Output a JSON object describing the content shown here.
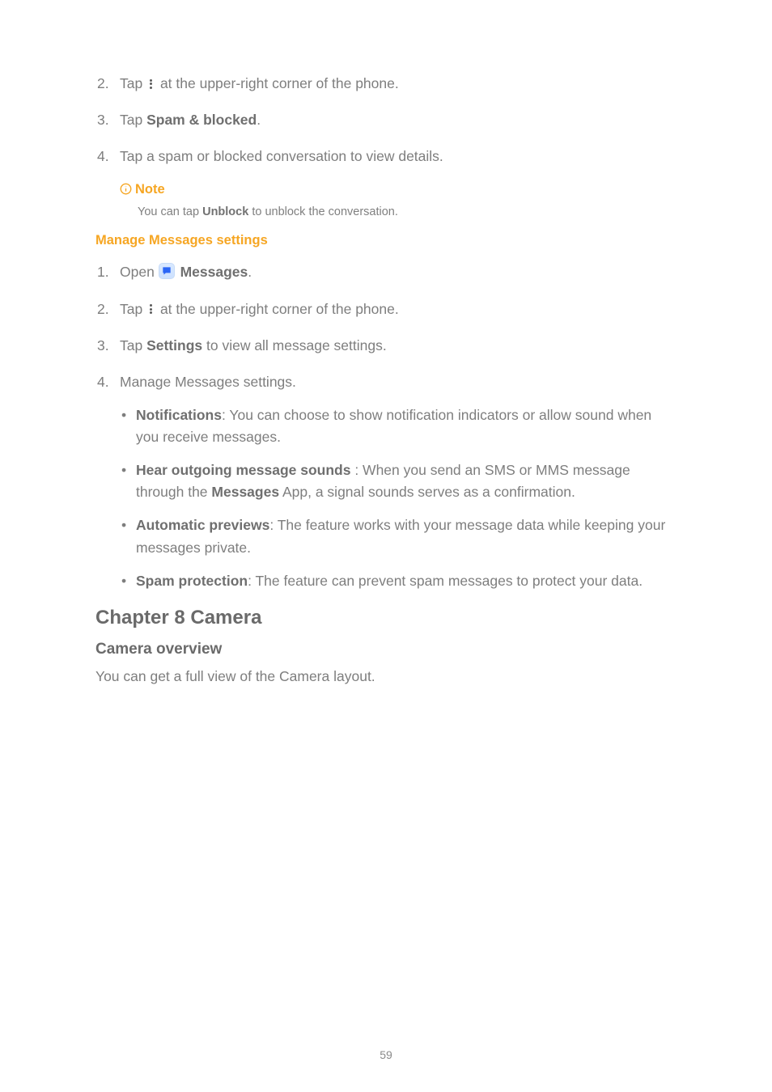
{
  "listA": {
    "i2_pre": "Tap ",
    "i2_post": " at the upper-right corner of the phone.",
    "i3_pre": "Tap ",
    "i3_bold": "Spam & blocked",
    "i3_post": ".",
    "i4": "Tap a spam or blocked conversation to view details."
  },
  "note": {
    "label": "Note",
    "body_pre": "You can tap ",
    "body_bold": "Unblock",
    "body_post": " to unblock the conversation."
  },
  "section_title": "Manage Messages settings",
  "listB": {
    "i1_pre": "Open ",
    "i1_bold": "Messages",
    "i1_post": ".",
    "i2_pre": "Tap ",
    "i2_post": " at the upper-right corner of the phone.",
    "i3_pre": "Tap ",
    "i3_bold": "Settings",
    "i3_post": " to view all message settings.",
    "i4": "Manage Messages settings."
  },
  "bullets": {
    "b1_bold": "Notifications",
    "b1_rest": ": You can choose to show notification indicators or allow sound when you receive messages.",
    "b2_bold": "Hear outgoing message sounds ",
    "b2_mid": ": When you send an SMS or MMS message through the ",
    "b2_bold2": "Messages",
    "b2_rest": " App, a signal sounds serves as a confirmation.",
    "b3_bold": "Automatic previews",
    "b3_rest": ": The feature works with your message data while keeping your messages private.",
    "b4_bold": "Spam protection",
    "b4_rest": ": The feature can prevent spam messages to protect your data."
  },
  "chapter": "Chapter 8 Camera",
  "camera_h": "Camera overview",
  "camera_p": "You can get a full view of the Camera layout.",
  "page_num": "59"
}
